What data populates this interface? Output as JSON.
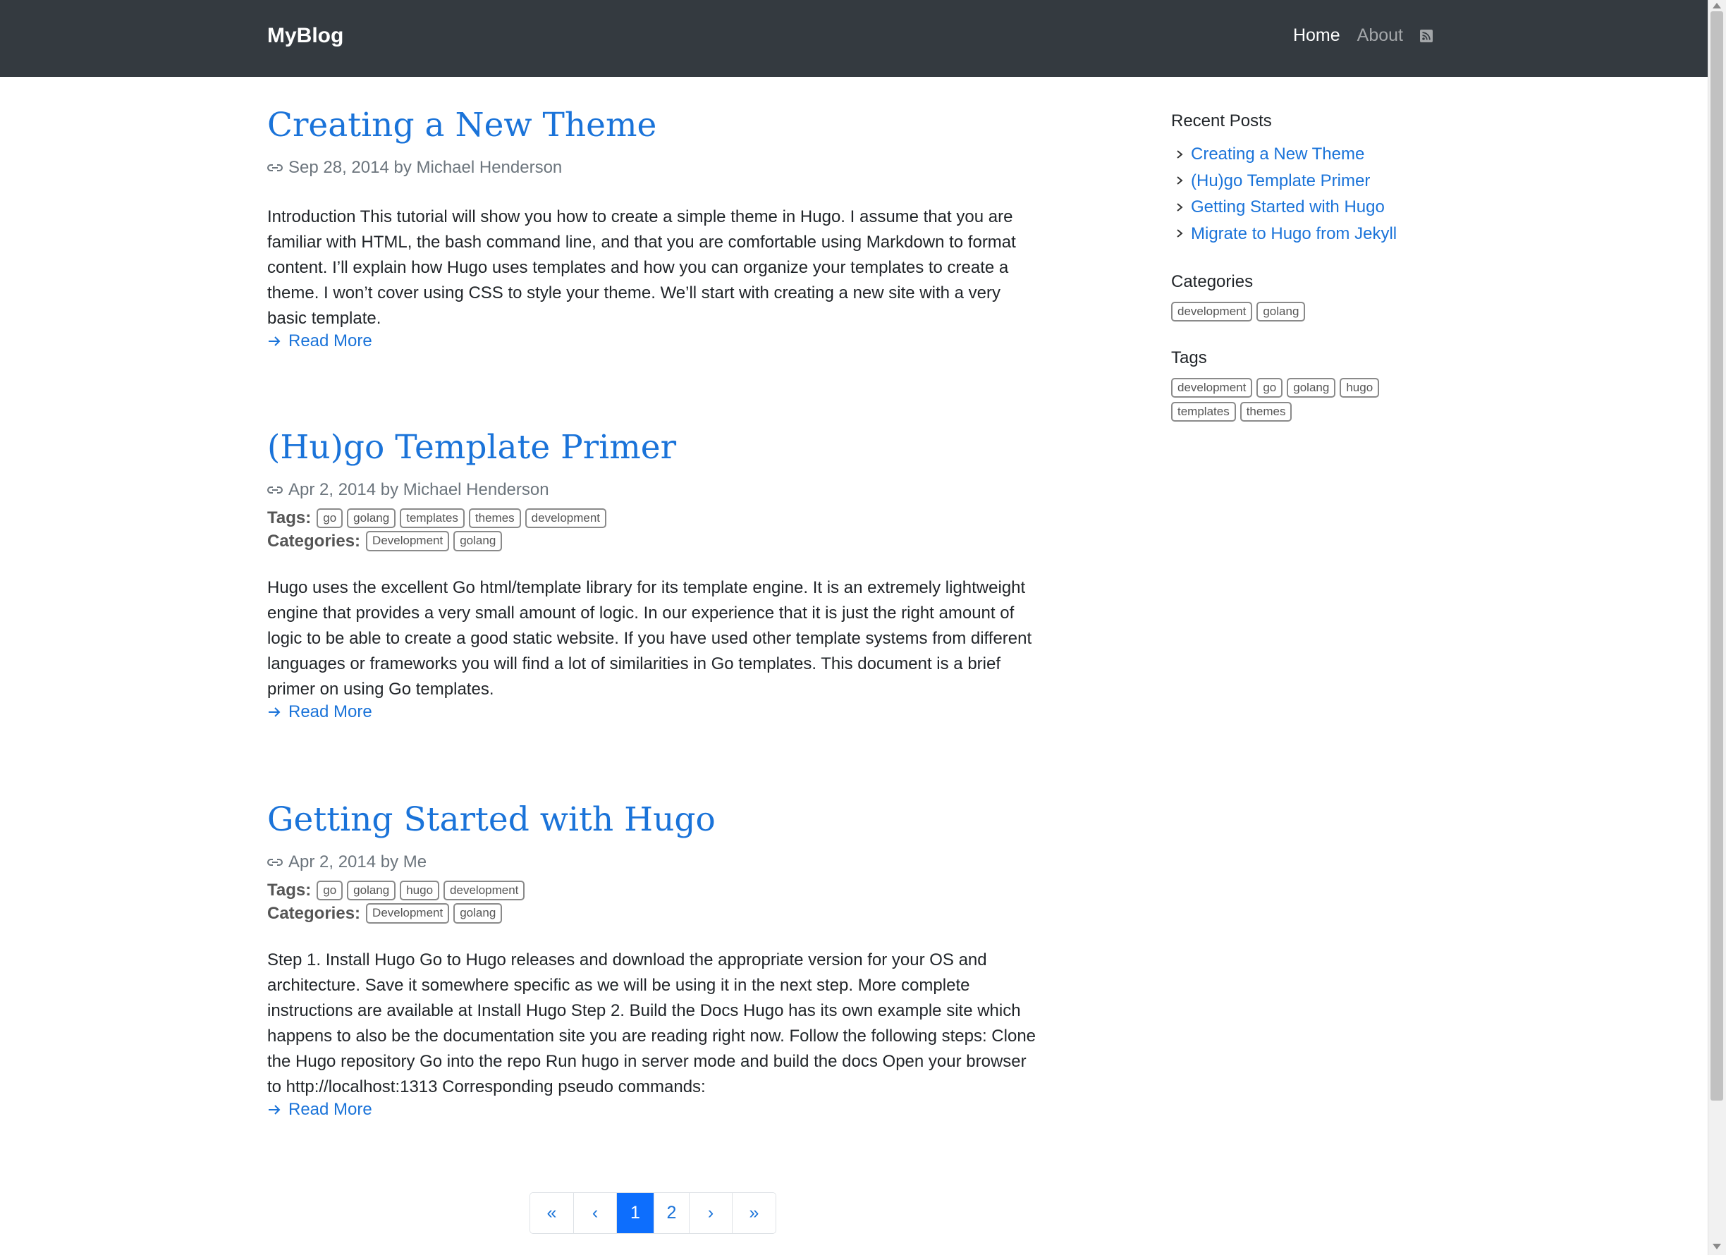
{
  "nav": {
    "brand": "MyBlog",
    "links": [
      {
        "label": "Home",
        "active": true
      },
      {
        "label": "About",
        "active": false
      }
    ]
  },
  "posts": [
    {
      "title": "Creating a New Theme",
      "date": "Sep 28, 2014",
      "author": "Michael Henderson",
      "summary": "Introduction This tutorial will show you how to create a simple theme in Hugo. I assume that you are familiar with HTML, the bash command line, and that you are comfortable using Markdown to format content. I’ll explain how Hugo uses templates and how you can organize your templates to create a theme. I won’t cover using CSS to style your theme. We’ll start with creating a new site with a very basic template.",
      "read_more": "Read More"
    },
    {
      "title": "(Hu)go Template Primer",
      "date": "Apr 2, 2014",
      "author": "Michael Henderson",
      "tags_label": "Tags:",
      "tags": [
        "go",
        "golang",
        "templates",
        "themes",
        "development"
      ],
      "categories_label": "Categories:",
      "categories": [
        "Development",
        "golang"
      ],
      "summary": "Hugo uses the excellent Go html/template library for its template engine. It is an extremely lightweight engine that provides a very small amount of logic. In our experience that it is just the right amount of logic to be able to create a good static website. If you have used other template systems from different languages or frameworks you will find a lot of similarities in Go templates. This document is a brief primer on using Go templates.",
      "read_more": "Read More"
    },
    {
      "title": "Getting Started with Hugo",
      "date": "Apr 2, 2014",
      "author": "Me",
      "tags_label": "Tags:",
      "tags": [
        "go",
        "golang",
        "hugo",
        "development"
      ],
      "categories_label": "Categories:",
      "categories": [
        "Development",
        "golang"
      ],
      "summary": "Step 1. Install Hugo Go to Hugo releases and download the appropriate version for your OS and architecture. Save it somewhere specific as we will be using it in the next step. More complete instructions are available at Install Hugo Step 2. Build the Docs Hugo has its own example site which happens to also be the documentation site you are reading right now. Follow the following steps: Clone the Hugo repository Go into the repo Run hugo in server mode and build the docs Open your browser to http://localhost:1313 Corresponding pseudo commands:",
      "read_more": "Read More"
    }
  ],
  "by_word": "by",
  "sidebar": {
    "recent_title": "Recent Posts",
    "recent": [
      "Creating a New Theme",
      "(Hu)go Template Primer",
      "Getting Started with Hugo",
      "Migrate to Hugo from Jekyll"
    ],
    "categories_title": "Categories",
    "categories": [
      "development",
      "golang"
    ],
    "tags_title": "Tags",
    "tags": [
      "development",
      "go",
      "golang",
      "hugo",
      "templates",
      "themes"
    ]
  },
  "pagination": {
    "first": "«",
    "prev": "‹",
    "pages": [
      "1",
      "2"
    ],
    "current": "1",
    "next": "›",
    "last": "»"
  },
  "colors": {
    "link": "#1a73d9",
    "navbar": "#343a40",
    "active_page": "#0d6efd"
  }
}
